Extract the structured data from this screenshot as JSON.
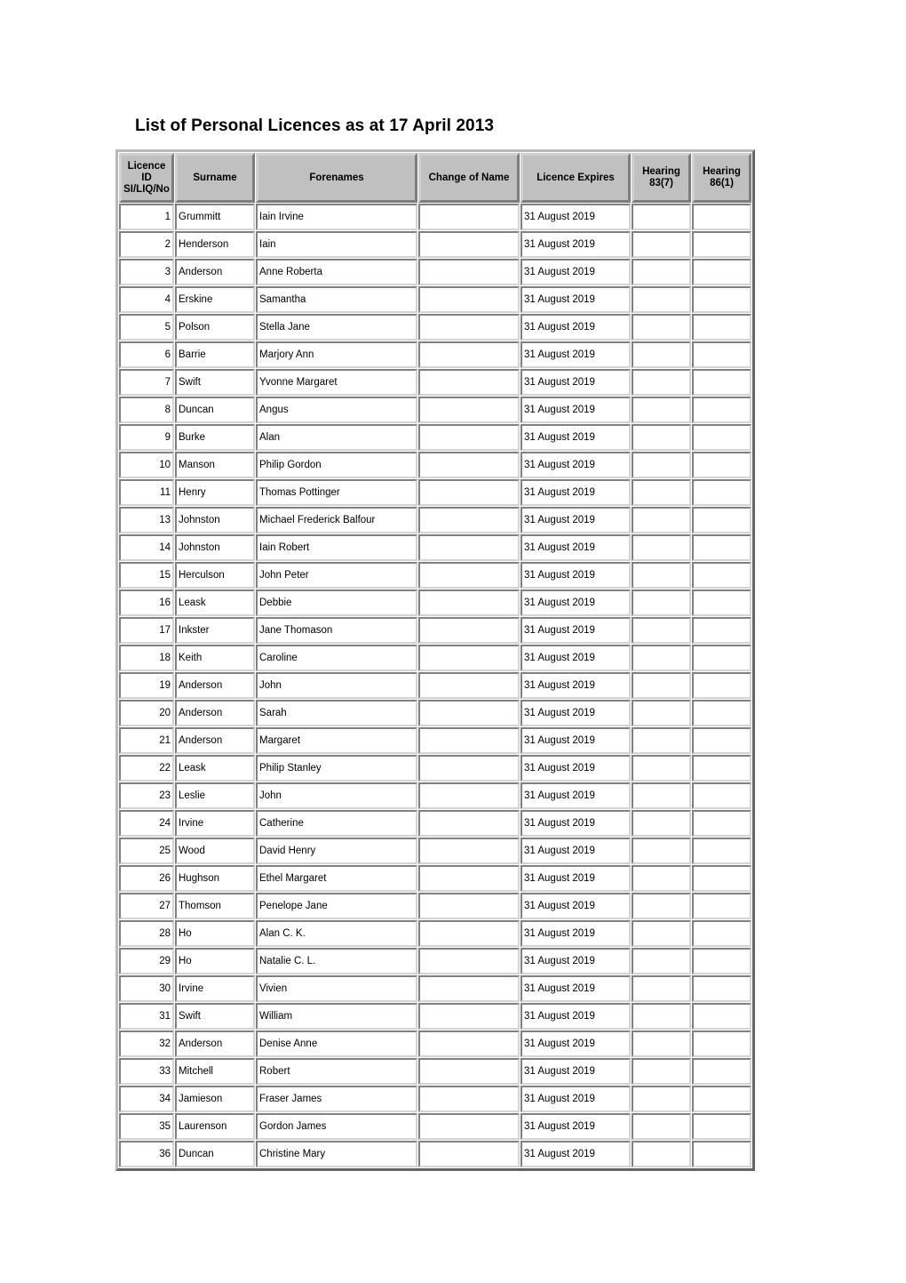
{
  "document": {
    "title": "List of Personal Licences as at 17 April 2013"
  },
  "table": {
    "columns": [
      {
        "key": "licence_id",
        "label_lines": [
          "Licence",
          "ID",
          "SI/LIQ/No"
        ]
      },
      {
        "key": "surname",
        "label_lines": [
          "Surname"
        ]
      },
      {
        "key": "forenames",
        "label_lines": [
          "Forenames"
        ]
      },
      {
        "key": "change_of_name",
        "label_lines": [
          "Change of Name"
        ]
      },
      {
        "key": "licence_expires",
        "label_lines": [
          "Licence Expires"
        ]
      },
      {
        "key": "hearing_83_7",
        "label_lines": [
          "Hearing",
          "83(7)"
        ]
      },
      {
        "key": "hearing_86_1",
        "label_lines": [
          "Hearing",
          "86(1)"
        ]
      }
    ],
    "header": {
      "licence_id_line1": "Licence",
      "licence_id_line2": "ID",
      "licence_id_line3": "SI/LIQ/No",
      "surname": "Surname",
      "forenames": "Forenames",
      "change_of_name": "Change of Name",
      "licence_expires": "Licence Expires",
      "hearing_83_7_line1": "Hearing",
      "hearing_83_7_line2": "83(7)",
      "hearing_86_1_line1": "Hearing",
      "hearing_86_1_line2": "86(1)"
    },
    "rows": [
      {
        "licence_id": "1",
        "surname": "Grummitt",
        "forenames": "Iain Irvine",
        "change_of_name": "",
        "licence_expires": "31 August 2019",
        "hearing_83_7": "",
        "hearing_86_1": ""
      },
      {
        "licence_id": "2",
        "surname": "Henderson",
        "forenames": "Iain",
        "change_of_name": "",
        "licence_expires": "31 August 2019",
        "hearing_83_7": "",
        "hearing_86_1": ""
      },
      {
        "licence_id": "3",
        "surname": "Anderson",
        "forenames": "Anne Roberta",
        "change_of_name": "",
        "licence_expires": "31 August 2019",
        "hearing_83_7": "",
        "hearing_86_1": ""
      },
      {
        "licence_id": "4",
        "surname": "Erskine",
        "forenames": "Samantha",
        "change_of_name": "",
        "licence_expires": "31 August 2019",
        "hearing_83_7": "",
        "hearing_86_1": ""
      },
      {
        "licence_id": "5",
        "surname": "Polson",
        "forenames": "Stella Jane",
        "change_of_name": "",
        "licence_expires": "31 August 2019",
        "hearing_83_7": "",
        "hearing_86_1": ""
      },
      {
        "licence_id": "6",
        "surname": "Barrie",
        "forenames": "Marjory Ann",
        "change_of_name": "",
        "licence_expires": "31 August 2019",
        "hearing_83_7": "",
        "hearing_86_1": ""
      },
      {
        "licence_id": "7",
        "surname": "Swift",
        "forenames": "Yvonne Margaret",
        "change_of_name": "",
        "licence_expires": "31 August 2019",
        "hearing_83_7": "",
        "hearing_86_1": ""
      },
      {
        "licence_id": "8",
        "surname": "Duncan",
        "forenames": "Angus",
        "change_of_name": "",
        "licence_expires": "31 August 2019",
        "hearing_83_7": "",
        "hearing_86_1": ""
      },
      {
        "licence_id": "9",
        "surname": "Burke",
        "forenames": "Alan",
        "change_of_name": "",
        "licence_expires": "31 August 2019",
        "hearing_83_7": "",
        "hearing_86_1": ""
      },
      {
        "licence_id": "10",
        "surname": "Manson",
        "forenames": "Philip Gordon",
        "change_of_name": "",
        "licence_expires": "31 August 2019",
        "hearing_83_7": "",
        "hearing_86_1": ""
      },
      {
        "licence_id": "11",
        "surname": "Henry",
        "forenames": "Thomas Pottinger",
        "change_of_name": "",
        "licence_expires": "31 August 2019",
        "hearing_83_7": "",
        "hearing_86_1": ""
      },
      {
        "licence_id": "13",
        "surname": "Johnston",
        "forenames": "Michael Frederick Balfour",
        "change_of_name": "",
        "licence_expires": "31 August 2019",
        "hearing_83_7": "",
        "hearing_86_1": ""
      },
      {
        "licence_id": "14",
        "surname": "Johnston",
        "forenames": "Iain Robert",
        "change_of_name": "",
        "licence_expires": "31 August 2019",
        "hearing_83_7": "",
        "hearing_86_1": ""
      },
      {
        "licence_id": "15",
        "surname": "Herculson",
        "forenames": "John Peter",
        "change_of_name": "",
        "licence_expires": "31 August 2019",
        "hearing_83_7": "",
        "hearing_86_1": ""
      },
      {
        "licence_id": "16",
        "surname": "Leask",
        "forenames": "Debbie",
        "change_of_name": "",
        "licence_expires": "31 August 2019",
        "hearing_83_7": "",
        "hearing_86_1": ""
      },
      {
        "licence_id": "17",
        "surname": "Inkster",
        "forenames": "Jane Thomason",
        "change_of_name": "",
        "licence_expires": "31 August 2019",
        "hearing_83_7": "",
        "hearing_86_1": ""
      },
      {
        "licence_id": "18",
        "surname": "Keith",
        "forenames": "Caroline",
        "change_of_name": "",
        "licence_expires": "31 August 2019",
        "hearing_83_7": "",
        "hearing_86_1": ""
      },
      {
        "licence_id": "19",
        "surname": "Anderson",
        "forenames": "John",
        "change_of_name": "",
        "licence_expires": "31 August 2019",
        "hearing_83_7": "",
        "hearing_86_1": ""
      },
      {
        "licence_id": "20",
        "surname": "Anderson",
        "forenames": "Sarah",
        "change_of_name": "",
        "licence_expires": "31 August 2019",
        "hearing_83_7": "",
        "hearing_86_1": ""
      },
      {
        "licence_id": "21",
        "surname": "Anderson",
        "forenames": "Margaret",
        "change_of_name": "",
        "licence_expires": "31 August 2019",
        "hearing_83_7": "",
        "hearing_86_1": ""
      },
      {
        "licence_id": "22",
        "surname": "Leask",
        "forenames": "Philip Stanley",
        "change_of_name": "",
        "licence_expires": "31 August 2019",
        "hearing_83_7": "",
        "hearing_86_1": ""
      },
      {
        "licence_id": "23",
        "surname": "Leslie",
        "forenames": "John",
        "change_of_name": "",
        "licence_expires": "31 August 2019",
        "hearing_83_7": "",
        "hearing_86_1": ""
      },
      {
        "licence_id": "24",
        "surname": "Irvine",
        "forenames": "Catherine",
        "change_of_name": "",
        "licence_expires": "31 August 2019",
        "hearing_83_7": "",
        "hearing_86_1": ""
      },
      {
        "licence_id": "25",
        "surname": "Wood",
        "forenames": "David Henry",
        "change_of_name": "",
        "licence_expires": "31 August 2019",
        "hearing_83_7": "",
        "hearing_86_1": ""
      },
      {
        "licence_id": "26",
        "surname": "Hughson",
        "forenames": "Ethel Margaret",
        "change_of_name": "",
        "licence_expires": "31 August 2019",
        "hearing_83_7": "",
        "hearing_86_1": ""
      },
      {
        "licence_id": "27",
        "surname": "Thomson",
        "forenames": "Penelope Jane",
        "change_of_name": "",
        "licence_expires": "31 August 2019",
        "hearing_83_7": "",
        "hearing_86_1": ""
      },
      {
        "licence_id": "28",
        "surname": "Ho",
        "forenames": "Alan C. K.",
        "change_of_name": "",
        "licence_expires": "31 August 2019",
        "hearing_83_7": "",
        "hearing_86_1": ""
      },
      {
        "licence_id": "29",
        "surname": "Ho",
        "forenames": "Natalie C. L.",
        "change_of_name": "",
        "licence_expires": "31 August 2019",
        "hearing_83_7": "",
        "hearing_86_1": ""
      },
      {
        "licence_id": "30",
        "surname": "Irvine",
        "forenames": "Vivien",
        "change_of_name": "",
        "licence_expires": "31 August 2019",
        "hearing_83_7": "",
        "hearing_86_1": ""
      },
      {
        "licence_id": "31",
        "surname": "Swift",
        "forenames": "William",
        "change_of_name": "",
        "licence_expires": "31 August 2019",
        "hearing_83_7": "",
        "hearing_86_1": ""
      },
      {
        "licence_id": "32",
        "surname": "Anderson",
        "forenames": "Denise Anne",
        "change_of_name": "",
        "licence_expires": "31 August 2019",
        "hearing_83_7": "",
        "hearing_86_1": ""
      },
      {
        "licence_id": "33",
        "surname": "Mitchell",
        "forenames": "Robert",
        "change_of_name": "",
        "licence_expires": "31 August 2019",
        "hearing_83_7": "",
        "hearing_86_1": ""
      },
      {
        "licence_id": "34",
        "surname": "Jamieson",
        "forenames": "Fraser James",
        "change_of_name": "",
        "licence_expires": "31 August 2019",
        "hearing_83_7": "",
        "hearing_86_1": ""
      },
      {
        "licence_id": "35",
        "surname": "Laurenson",
        "forenames": "Gordon James",
        "change_of_name": "",
        "licence_expires": "31 August 2019",
        "hearing_83_7": "",
        "hearing_86_1": ""
      },
      {
        "licence_id": "36",
        "surname": "Duncan",
        "forenames": "Christine Mary",
        "change_of_name": "",
        "licence_expires": "31 August 2019",
        "hearing_83_7": "",
        "hearing_86_1": ""
      }
    ]
  },
  "colors": {
    "header_background": "#c0c0c0",
    "page_background": "#ffffff",
    "text": "#000000",
    "cell_border": "#d4d4d4",
    "table_border": "#b9b9b9"
  }
}
